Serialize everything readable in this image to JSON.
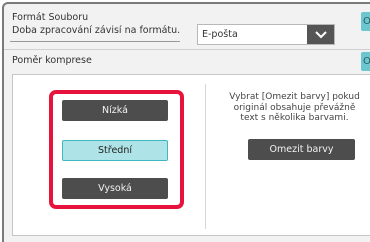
{
  "header": {
    "title": "Formát Souboru",
    "subtitle": "Doba zpracování závisí na formátu.",
    "format_select": {
      "value": "E-pošta"
    },
    "ok_label": "OK"
  },
  "section": {
    "label": "Poměr komprese"
  },
  "compression": {
    "options": [
      "Nízká",
      "Střední",
      "Vysoká"
    ],
    "selected": "Střední"
  },
  "reduce_colors": {
    "description_lines": [
      "Vybrat [Omezit barvy] pokud",
      "originál obsahuje převážně",
      "text s několika barvami."
    ],
    "button_label": "Omezit barvy"
  },
  "colors": {
    "highlight": "#e8133d",
    "accent": "#6cc6cf",
    "button_dark": "#4d4d4d",
    "selected_fill": "#aee3e7"
  }
}
